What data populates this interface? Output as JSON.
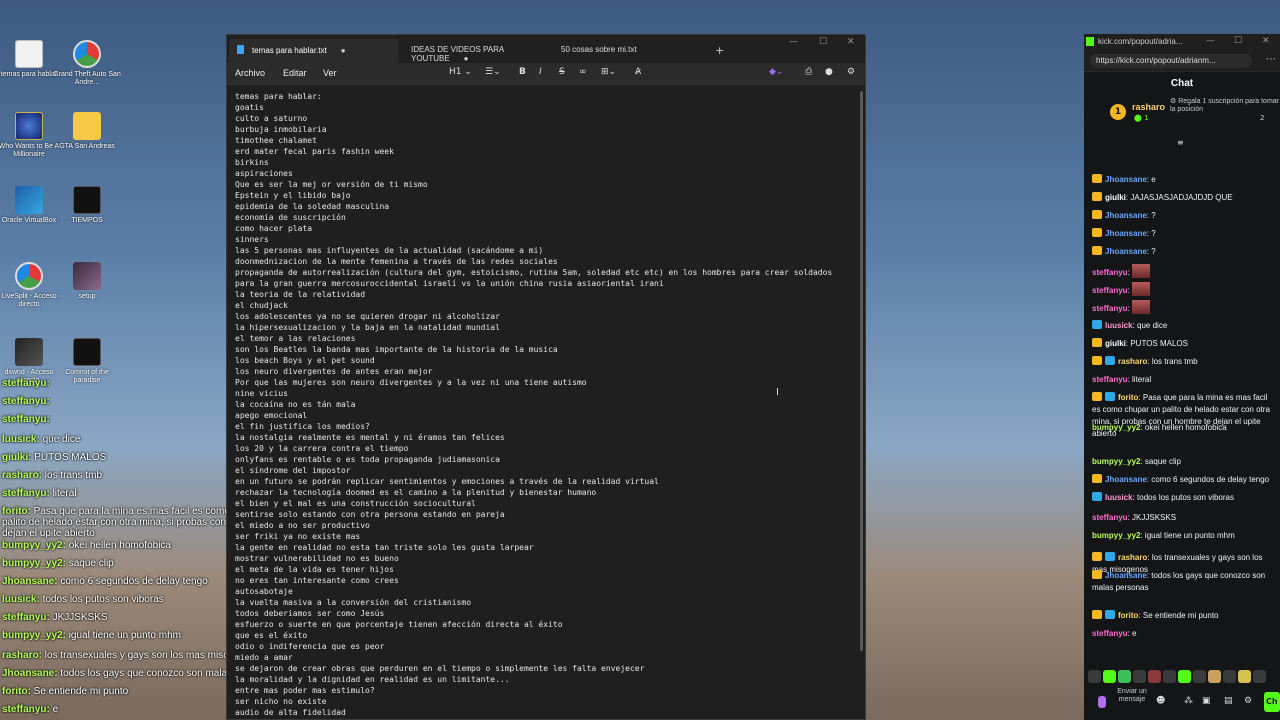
{
  "desktop": {
    "icons": [
      {
        "label": "temas para hablar",
        "icon": "text-document-icon"
      },
      {
        "label": "Grand Theft Auto San Andre...",
        "icon": "rgb-app-icon"
      },
      {
        "label": "Who Wants to Be A Millionaire",
        "icon": "game-icon"
      },
      {
        "label": "GTA San Andreas",
        "icon": "folder-icon"
      },
      {
        "label": "Oracle VirtualBox",
        "icon": "virtualbox-icon"
      },
      {
        "label": "TIEMPOS",
        "icon": "terminal-icon"
      },
      {
        "label": "LiveSplit - Acceso directo",
        "icon": "rgb-app-icon"
      },
      {
        "label": "setup",
        "icon": "image-icon"
      },
      {
        "label": "dxwnd - Acceso directo",
        "icon": "app-icon"
      },
      {
        "label": "Commit of the paradise",
        "icon": "image-icon"
      }
    ]
  },
  "overlay": {
    "messages": [
      {
        "user": "steffanyu:",
        "text": ""
      },
      {
        "user": "steffanyu:",
        "text": ""
      },
      {
        "user": "steffanyu:",
        "text": ""
      },
      {
        "user": "luusick:",
        "text": "que dice"
      },
      {
        "user": "giulki:",
        "text": "PUTOS MALOS"
      },
      {
        "user": "rasharo:",
        "text": "los trans tmb"
      },
      {
        "user": "steffanyu:",
        "text": "literal"
      },
      {
        "user": "forito:",
        "text": "Pasa que para la mina es mas facil es como chupar un palito de helado estar con otra mina, si probas con un hombre te dejan el upite abierto"
      },
      {
        "user": "bumpyy_yy2:",
        "text": "okei hellen homofobica"
      },
      {
        "user": "bumpyy_yy2:",
        "text": "saque clip"
      },
      {
        "user": "Jhoansane:",
        "text": "como 6 segundos de delay tengo"
      },
      {
        "user": "luusick:",
        "text": "todos los putos son viboras"
      },
      {
        "user": "steffanyu:",
        "text": "JKJJSKSKS"
      },
      {
        "user": "bumpyy_yy2:",
        "text": "igual tiene un punto mhm"
      },
      {
        "user": "rasharo:",
        "text": "los transexuales y gays son los mas misogenos"
      },
      {
        "user": "Jhoansane:",
        "text": "todos los gays que conozco son malas personas"
      },
      {
        "user": "forito:",
        "text": "Se entiende mi punto"
      },
      {
        "user": "steffanyu:",
        "text": "e"
      }
    ]
  },
  "notepad": {
    "tabs": [
      {
        "label": "temas para hablar.txt",
        "active": true
      },
      {
        "label": "IDEAS DE VIDEOS PARA YOUTUBE",
        "active": false
      },
      {
        "label": "50 cosas sobre mi.txt",
        "active": false
      }
    ],
    "menu": {
      "file": "Archivo",
      "edit": "Editar",
      "view": "Ver",
      "heading": "H1"
    },
    "lines": [
      "temas para hablar:",
      "goatis",
      "culto a saturno",
      "burbuja inmobilaria",
      "timothee chalamet",
      "erd mater fecal paris fashin week",
      "birkins",
      "aspiraciones",
      "Que es ser la mej or versión de ti mismo",
      "Epstein y el libido bajo",
      "epidemia de la soledad masculina",
      "economía de suscripción",
      "como hacer plata",
      "sinners",
      "las 5 personas mas influyentes de la actualidad (sacándome a mi)",
      "doonmednizacion de la mente femenina a través de las redes sociales",
      "propaganda de autorrealización (cultura del gym, estoicismo, rutina 5am, soledad etc etc) en los hombres para crear soldados",
      "para la gran guerra mercosuroccidental israelí vs la unión china rusia asiaoriental irani",
      "la teoria de la relatividad",
      "el chudjack",
      "los adolescentes ya no se quieren drogar ni alcoholizar",
      "la hipersexualizacion y la baja en la natalidad mundial",
      "el temor a las relaciones",
      "son los Beatles la banda mas importante de la historia de la musica",
      "los beach Boys y el pet sound",
      "los neuro divergentes de antes eran mejor",
      "Por que las mujeres son neuro divergentes y a la vez ni una tiene autismo",
      "nine vicius",
      "la cocaína no es tán mala",
      "apego emocional",
      "el fin justifica los medios?",
      "la nostalgia realmente es mental y ni éramos tan felices",
      "los 20 y la carrera contra el tiempo",
      "onlyfans es rentable o es toda propaganda judiamasonica",
      "el síndrome del impostor",
      "en un futuro se podrán replicar sentimientos y emociones a través de la realidad virtual",
      "rechazar la tecnología doomed es el camino a la plenitud y bienestar humano",
      "el bien y el mal es una construcción sociocultural",
      "sentirse solo estando con otra persona estando en pareja",
      "el miedo a no ser productivo",
      "ser friki ya no existe mas",
      "la gente en realidad no esta tan triste solo les gusta larpear",
      "mostrar vulnerabilidad no es bueno",
      "el meta de la vida es tener hijos",
      "no eres tan interesante como crees",
      "autosabotaje",
      "la vuelta masiva a la conversión del cristianismo",
      "todos deberiamos ser como Jesús",
      "esfuerzo o suerte en que porcentaje tienen afección directa al éxito",
      "que es el éxito",
      "odio o indiferencia que es peor",
      "miedo a amar",
      "se dejaron de crear obras que perduren en el tiempo o simplemente les falta envejecer",
      "la moralidad y la dignidad en realidad es un limitante...",
      "entre mas poder mas estimulo?",
      "ser nicho no existe",
      "audio de alta fidelidad"
    ]
  },
  "kick": {
    "window_title": "kick.com/popout/adria...",
    "url": "https://kick.com/popout/adrianm...",
    "chat_title": "Chat",
    "pinned": {
      "rank": "1",
      "user": "rasharo",
      "subs": "1",
      "gift_text": "Regala 1 suscripción para tomar la posición",
      "count": "2"
    },
    "messages": [
      {
        "user": "Jhoansane",
        "text": "e",
        "color": "#6aa8ff",
        "badge": "gold"
      },
      {
        "user": "giulki",
        "text": "JAJASJASJADJAJDJD QUE",
        "color": "#ffffff",
        "badge": "gold"
      },
      {
        "user": "Jhoansane",
        "text": "?",
        "color": "#6aa8ff",
        "badge": "gold"
      },
      {
        "user": "Jhoansane",
        "text": "?",
        "color": "#6aa8ff",
        "badge": "gold"
      },
      {
        "user": "Jhoansane",
        "text": "?",
        "color": "#6aa8ff",
        "badge": "gold"
      },
      {
        "user": "steffanyu",
        "text": "",
        "color": "#ff6bd2",
        "badge": "none",
        "emote": true
      },
      {
        "user": "steffanyu",
        "text": "",
        "color": "#ff6bd2",
        "badge": "none",
        "emote": true
      },
      {
        "user": "steffanyu",
        "text": "",
        "color": "#ff6bd2",
        "badge": "none",
        "emote": true
      },
      {
        "user": "luusick",
        "text": "que dice",
        "color": "#ff9ad5",
        "badge": "blue"
      },
      {
        "user": "giulki",
        "text": "PUTOS MALOS",
        "color": "#ffffff",
        "badge": "gold"
      },
      {
        "user": "rasharo",
        "text": "los trans tmb",
        "color": "#ffd86a",
        "badge": "multi"
      },
      {
        "user": "steffanyu",
        "text": "literal",
        "color": "#ff6bd2",
        "badge": "none"
      },
      {
        "user": "forito",
        "text": "Pasa que para la mina es mas facil es como chupar un palito de helado estar con otra mina, si probas con un hombre te dejan el upite abierto",
        "color": "#ffd86a",
        "badge": "multi"
      },
      {
        "user": "bumpyy_yy2",
        "text": "okei hellen homofobica",
        "color": "#b7ff5a",
        "badge": "none"
      },
      {
        "user": "bumpyy_yy2",
        "text": "saque clip",
        "color": "#b7ff5a",
        "badge": "none"
      },
      {
        "user": "Jhoansane",
        "text": "como 6 segundos de delay tengo",
        "color": "#6aa8ff",
        "badge": "gold"
      },
      {
        "user": "luusick",
        "text": "todos los putos son viboras",
        "color": "#ff9ad5",
        "badge": "blue"
      },
      {
        "user": "steffanyu",
        "text": "JKJJSKSKS",
        "color": "#ff6bd2",
        "badge": "none"
      },
      {
        "user": "bumpyy_yy2",
        "text": "igual tiene un punto mhm",
        "color": "#b7ff5a",
        "badge": "none"
      },
      {
        "user": "rasharo",
        "text": "los transexuales y gays son los mas misogenos",
        "color": "#ffd86a",
        "badge": "multi"
      },
      {
        "user": "Jhoansane",
        "text": "todos los gays que conozco son malas personas",
        "color": "#6aa8ff",
        "badge": "gold"
      },
      {
        "user": "forito",
        "text": "Se entiende mi punto",
        "color": "#ffd86a",
        "badge": "multi"
      },
      {
        "user": "steffanyu",
        "text": "e",
        "color": "#ff6bd2",
        "badge": "none"
      }
    ],
    "send_label": "Enviar un mensaje",
    "chat_button": "Ch"
  },
  "colors": {
    "kick_green": "#53fc18",
    "notepad_bg": "#1f1f1f"
  }
}
